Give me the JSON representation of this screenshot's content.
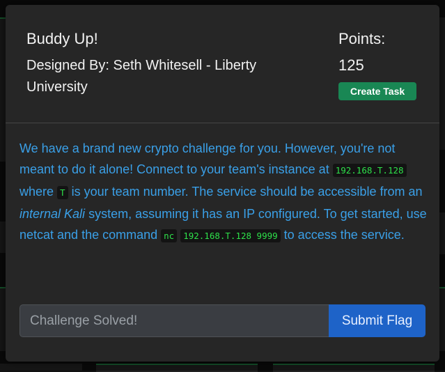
{
  "modal": {
    "title": "Buddy Up!",
    "designer": "Designed By: Seth Whitesell - Liberty University",
    "points_label": "Points:",
    "points_value": "125",
    "create_task_label": "Create Task",
    "description": {
      "p1": "We have a brand new crypto challenge for you. However, you're not meant to do it alone! Connect to your team's instance at ",
      "ip": "192.168.T.128",
      "p2": " where ",
      "t": "T",
      "p3": " is your team number. The service should be accessible from an ",
      "em": "internal Kali",
      "p4": " system, assuming it has an IP configured. To get started, use netcat and the command ",
      "cmd1": "nc",
      "p5": " ",
      "cmd2": "192.168.T.128 9999",
      "p6": " to access the service."
    },
    "flag_input_placeholder": "Challenge Solved!",
    "submit_label": "Submit Flag"
  },
  "colors": {
    "modal_bg": "#262626",
    "description": "#3aa0e8",
    "code": "#2ee04a",
    "create_task": "#198754",
    "submit": "#1e63c8"
  }
}
